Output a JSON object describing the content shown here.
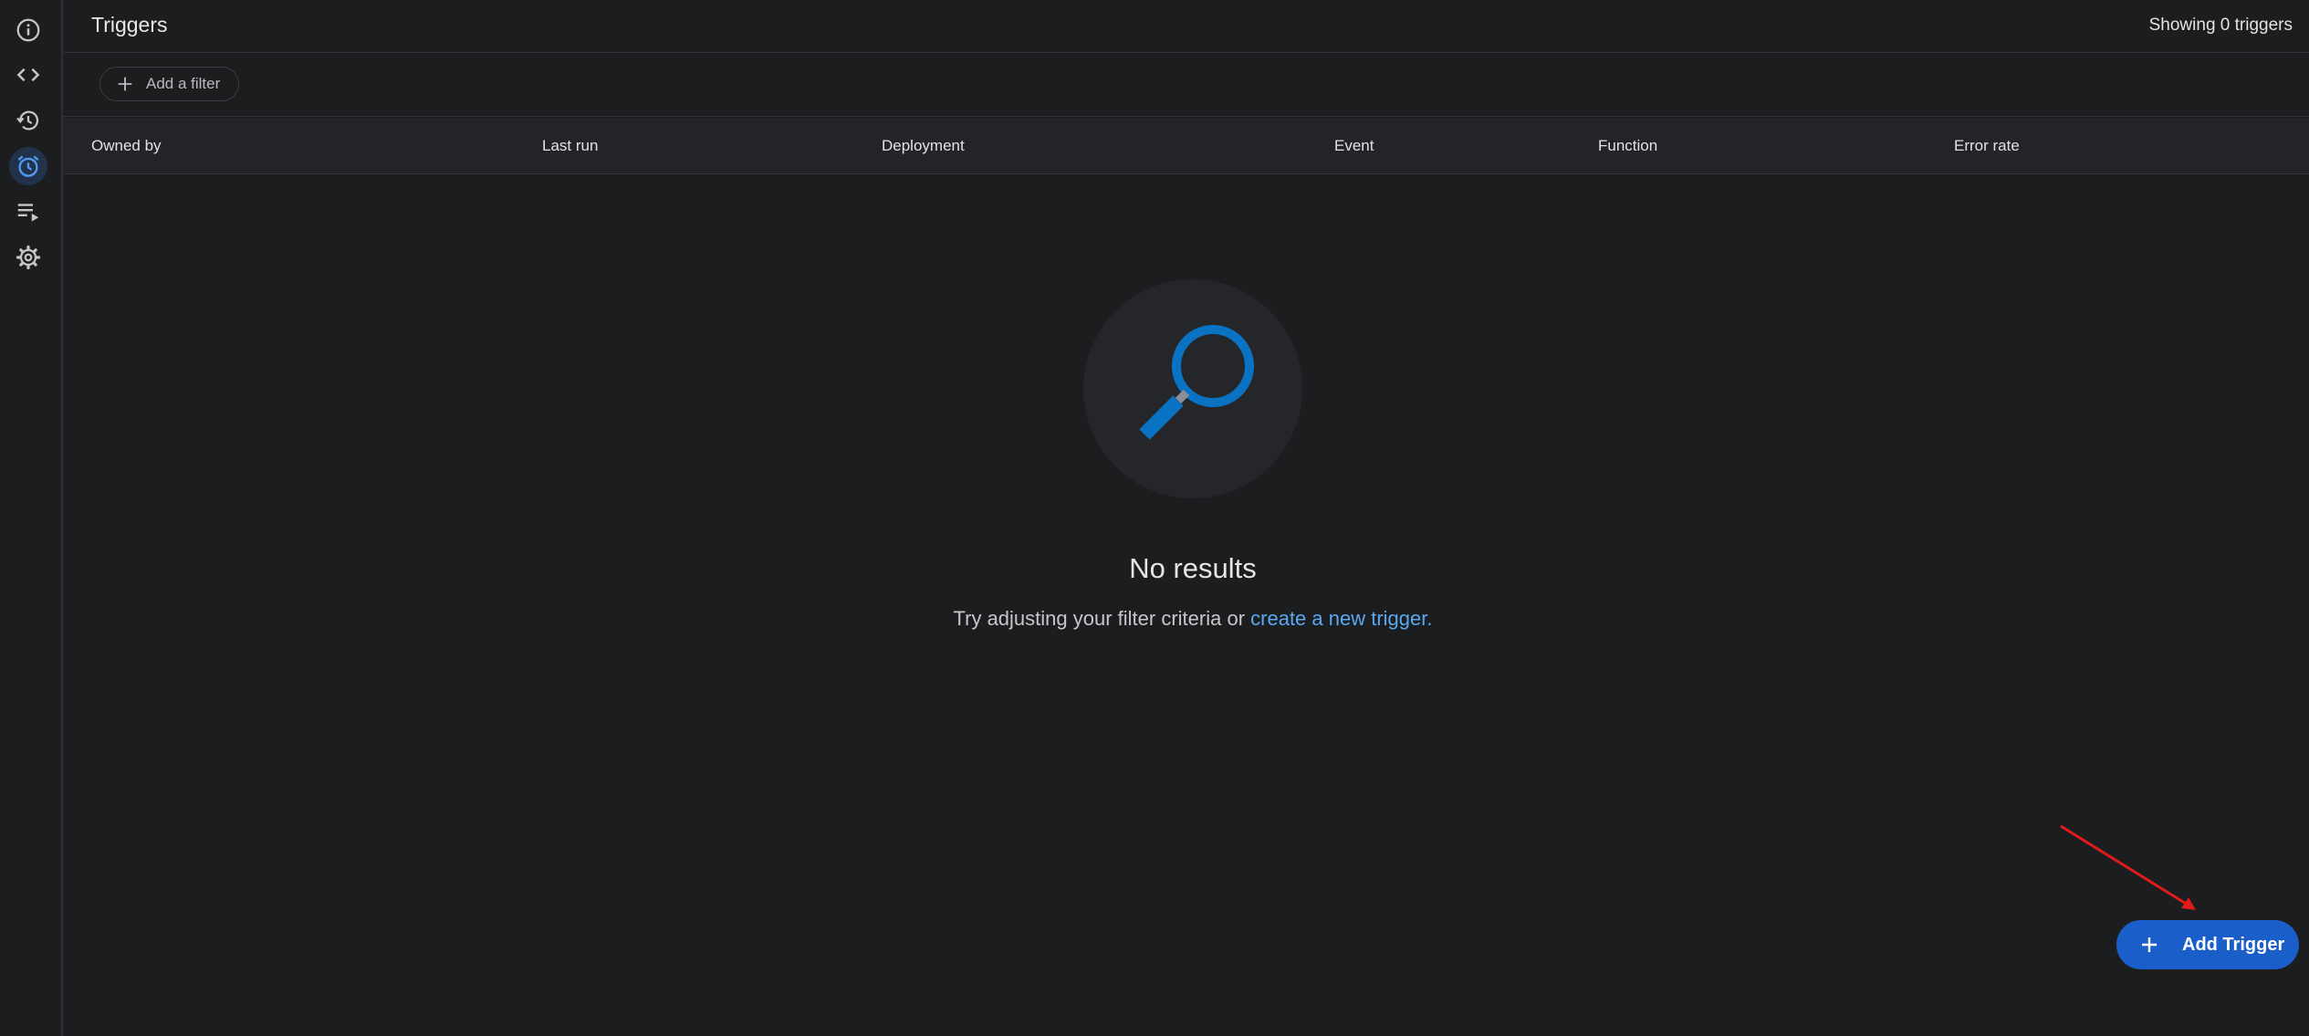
{
  "header": {
    "title": "Triggers",
    "count_text": "Showing 0 triggers"
  },
  "sidebar": {
    "items": [
      {
        "icon": "info-icon",
        "active": false
      },
      {
        "icon": "code-icon",
        "active": false
      },
      {
        "icon": "history-icon",
        "active": false
      },
      {
        "icon": "alarm-clock-icon",
        "active": true
      },
      {
        "icon": "playlist-play-icon",
        "active": false
      },
      {
        "icon": "gear-icon",
        "active": false
      }
    ]
  },
  "filter": {
    "add_label": "Add a filter"
  },
  "table": {
    "columns": [
      "Owned by",
      "Last run",
      "Deployment",
      "Event",
      "Function",
      "Error rate"
    ]
  },
  "empty_state": {
    "title": "No results",
    "message_prefix": "Try adjusting your filter criteria or ",
    "link_text": "create a new trigger."
  },
  "fab": {
    "label": "Add Trigger"
  },
  "colors": {
    "background": "#1c1d1f",
    "accent": "#1a5fc9",
    "link": "#5aa8f0",
    "active_icon": "#4f9af0",
    "magnifier": "#0a72c3",
    "annotation_arrow": "#e01b1b"
  }
}
